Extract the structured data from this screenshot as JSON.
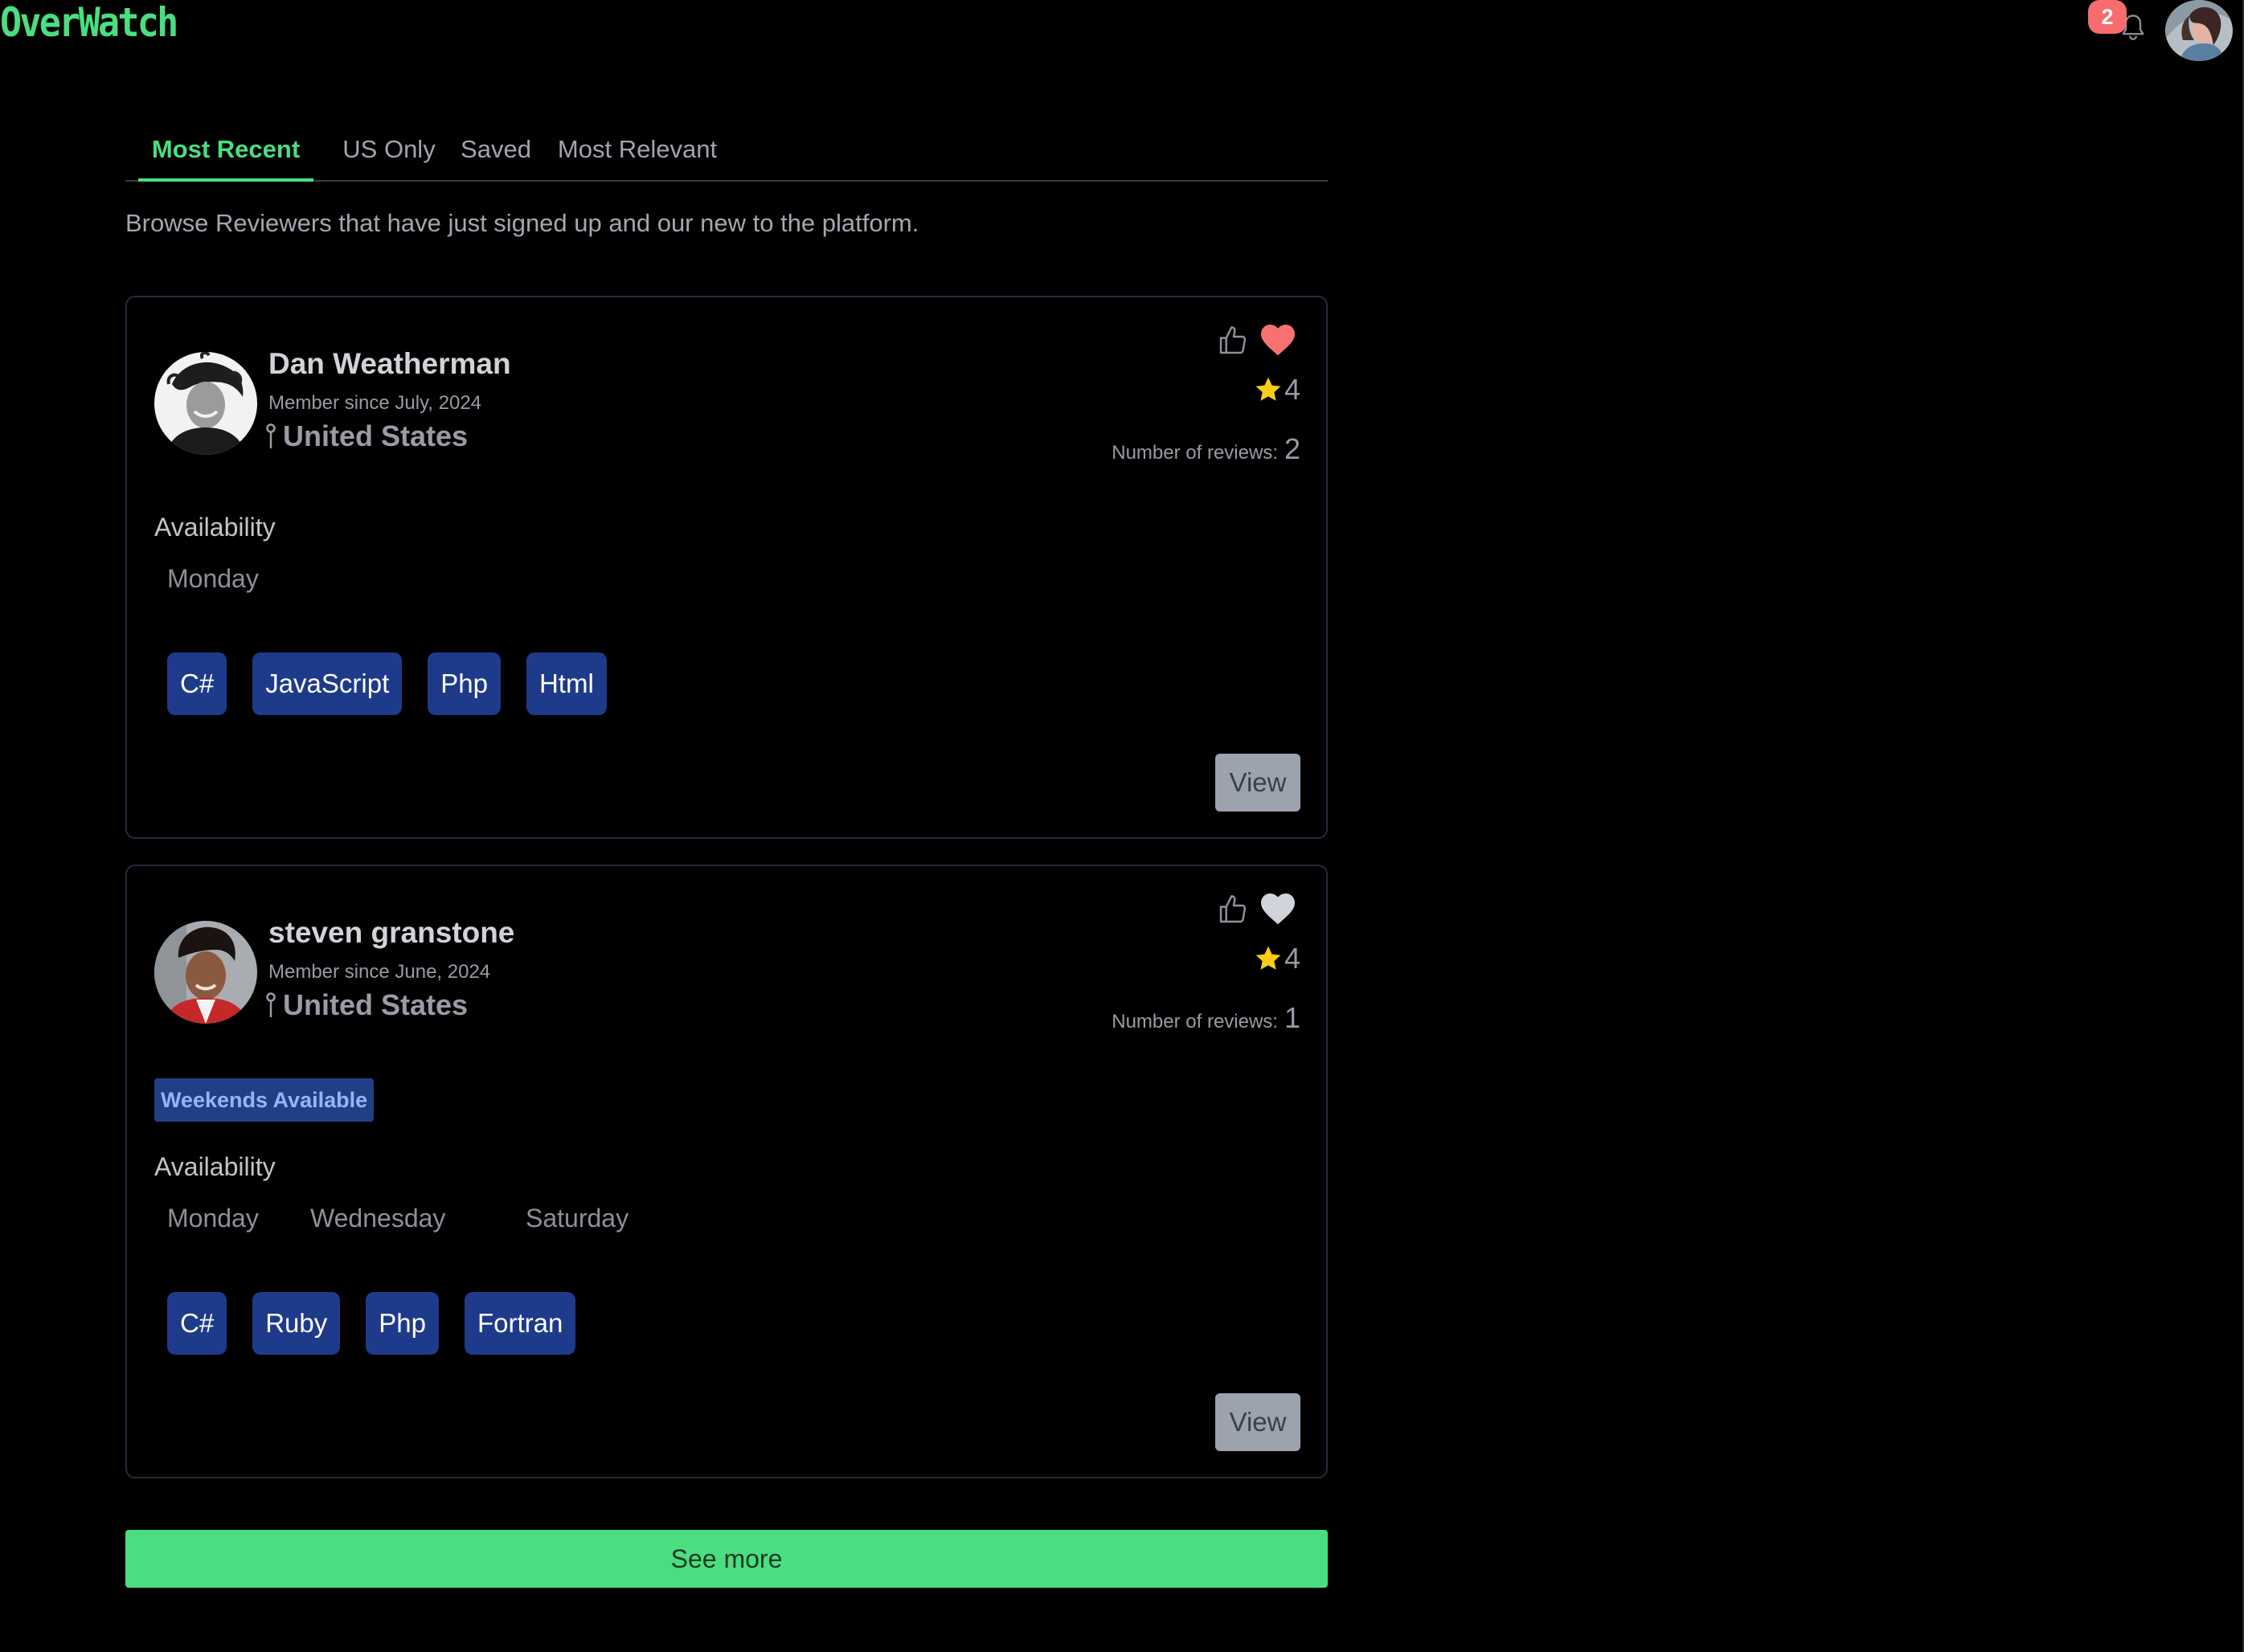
{
  "header": {
    "brand": "OverWatch",
    "notifications_count": "2"
  },
  "tabs": [
    {
      "label": "Most Recent",
      "active": true
    },
    {
      "label": "US Only",
      "active": false
    },
    {
      "label": "Saved",
      "active": false
    },
    {
      "label": "Most Relevant",
      "active": false
    }
  ],
  "intro": "Browse Reviewers that have just signed up and our new to the platform.",
  "reviewers": [
    {
      "name": "Dan Weatherman",
      "member_since": "Member since July, 2024",
      "location": "United States",
      "liked": true,
      "rating": "4",
      "reviews_label": "Number of reviews:",
      "reviews_count": "2",
      "badge": "",
      "availability_title": "Availability",
      "days": [
        "Monday"
      ],
      "skills": [
        "C#",
        "JavaScript",
        "Php",
        "Html"
      ],
      "view_label": "View"
    },
    {
      "name": "steven granstone",
      "member_since": "Member since June, 2024",
      "location": "United States",
      "liked": false,
      "rating": "4",
      "reviews_label": "Number of reviews:",
      "reviews_count": "1",
      "badge": "Weekends Available",
      "availability_title": "Availability",
      "days": [
        "Monday",
        "Wednesday",
        "Saturday"
      ],
      "skills": [
        "C#",
        "Ruby",
        "Php",
        "Fortran"
      ],
      "view_label": "View"
    }
  ],
  "see_more_label": "See more",
  "colors": {
    "accent": "#4ade80",
    "heart_liked": "#f87171",
    "heart_unliked": "#d1d5db",
    "star": "#facc15",
    "chip": "#1e3a8a",
    "badge_bg": "#1f3f87",
    "badge_text": "#93b6f4",
    "view_button": "#9ca3af",
    "notification_badge": "#f76d6d"
  },
  "icons": {
    "notifications": "bell-icon",
    "profile": "user-avatar",
    "location": "map-pin-icon",
    "like": "thumbs-up-icon",
    "favorite": "heart-icon",
    "rating": "star-icon"
  }
}
